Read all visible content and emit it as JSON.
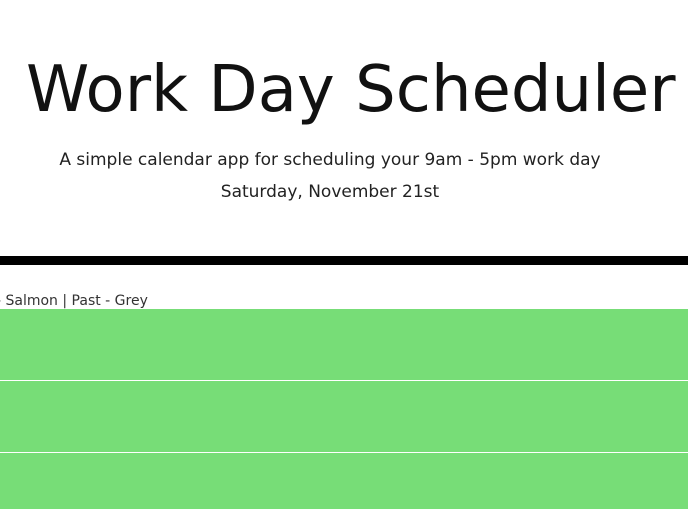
{
  "header": {
    "title": "Work Day Scheduler",
    "subtitle": "A simple calendar app for scheduling your 9am - 5pm work day",
    "current_date": "Saturday, November 21st"
  },
  "legend": {
    "text": "- Salmon | Past - Grey"
  },
  "colors": {
    "future": "#77dd77",
    "divider": "#000000"
  },
  "timeblocks": [
    {
      "status": "future"
    },
    {
      "status": "future"
    },
    {
      "status": "future"
    }
  ]
}
